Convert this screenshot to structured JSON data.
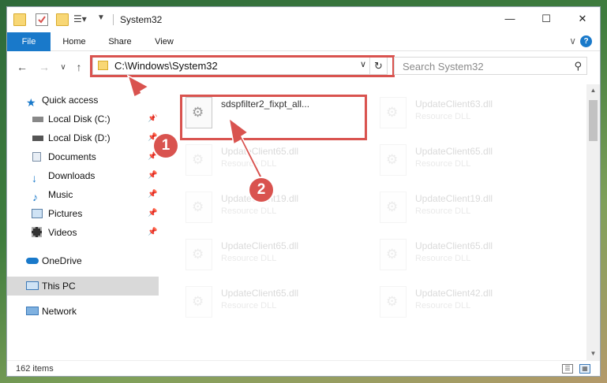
{
  "window": {
    "title": "System32",
    "controls": {
      "minimize": "—",
      "maximize": "☐",
      "close": "✕"
    }
  },
  "ribbon": {
    "tabs": [
      "File",
      "Home",
      "Share",
      "View"
    ],
    "expand": "∨",
    "help": "?"
  },
  "nav": {
    "back": "←",
    "forward": "→",
    "recent": "∨",
    "up": "↑",
    "address": "C:\\Windows\\System32",
    "address_dropdown": "∨",
    "refresh": "↻",
    "search_placeholder": "Search System32"
  },
  "sidebar": {
    "items": [
      {
        "label": "Quick access",
        "icon": "star-icon"
      },
      {
        "label": "Local Disk (C:)",
        "icon": "drive-icon",
        "pinned": true
      },
      {
        "label": "Local Disk (D:)",
        "icon": "drive-icon",
        "pinned": true
      },
      {
        "label": "Documents",
        "icon": "documents-icon",
        "pinned": true
      },
      {
        "label": "Downloads",
        "icon": "download-icon",
        "pinned": true
      },
      {
        "label": "Music",
        "icon": "music-icon",
        "pinned": true
      },
      {
        "label": "Pictures",
        "icon": "pictures-icon",
        "pinned": true
      },
      {
        "label": "Videos",
        "icon": "videos-icon",
        "pinned": true
      },
      {
        "label": "OneDrive",
        "icon": "cloud-icon"
      },
      {
        "label": "This PC",
        "icon": "monitor-icon",
        "selected": true
      },
      {
        "label": "Network",
        "icon": "network-icon"
      }
    ],
    "pin_glyph": "📌"
  },
  "files": [
    {
      "name": "sdspfilter2_fixpt_all...",
      "type": "",
      "highlighted": true
    },
    {
      "name": "UpdateClient63.dll",
      "type": "Resource DLL"
    },
    {
      "name": "UpdateClient65.dll",
      "type": "Resource DLL"
    },
    {
      "name": "UpdateClient65.dll",
      "type": "Resource DLL"
    },
    {
      "name": "UpdateClient19.dll",
      "type": "Resource DLL"
    },
    {
      "name": "UpdateClient19.dll",
      "type": "Resource DLL"
    },
    {
      "name": "UpdateClient65.dll",
      "type": "Resource DLL"
    },
    {
      "name": "UpdateClient65.dll",
      "type": "Resource DLL"
    },
    {
      "name": "UpdateClient65.dll",
      "type": "Resource DLL"
    },
    {
      "name": "UpdateClient42.dll",
      "type": "Resource DLL"
    }
  ],
  "status": {
    "items": "162 items"
  },
  "markers": [
    "1",
    "2"
  ],
  "colors": {
    "accent": "#1979ca",
    "annotation": "#d9534f"
  }
}
